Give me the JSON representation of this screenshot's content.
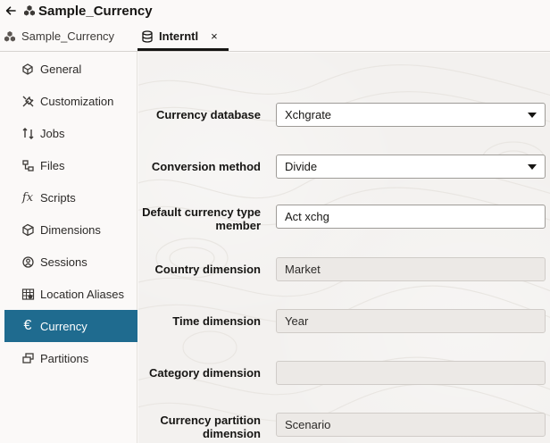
{
  "header": {
    "title": "Sample_Currency",
    "back_icon": "arrow-left-icon",
    "title_icon": "cube-cluster-icon"
  },
  "tabs": [
    {
      "label": "Sample_Currency",
      "icon": "cube-cluster-icon",
      "active": false
    },
    {
      "label": "Interntl",
      "icon": "database-icon",
      "active": true,
      "close": "×"
    }
  ],
  "sidebar": {
    "items": [
      {
        "label": "General",
        "icon": "cube-edit-icon",
        "active": false
      },
      {
        "label": "Customization",
        "icon": "tools-icon",
        "active": false
      },
      {
        "label": "Jobs",
        "icon": "jobs-icon",
        "active": false
      },
      {
        "label": "Files",
        "icon": "files-icon",
        "active": false
      },
      {
        "label": "Scripts",
        "icon": "fx-icon",
        "active": false
      },
      {
        "label": "Dimensions",
        "icon": "cube-dimensions-icon",
        "active": false
      },
      {
        "label": "Sessions",
        "icon": "sessions-icon",
        "active": false
      },
      {
        "label": "Location Aliases",
        "icon": "grid-link-icon",
        "active": false
      },
      {
        "label": "Currency",
        "icon": "euro-icon",
        "active": true
      },
      {
        "label": "Partitions",
        "icon": "partitions-icon",
        "active": false
      }
    ]
  },
  "form": {
    "fields": [
      {
        "label": "Currency database",
        "value": "Xchgrate",
        "type": "select"
      },
      {
        "label": "Conversion method",
        "value": "Divide",
        "type": "select"
      },
      {
        "label": "Default currency type member",
        "value": "Act xchg",
        "type": "input"
      },
      {
        "label": "Country dimension",
        "value": "Market",
        "type": "readonly"
      },
      {
        "label": "Time dimension",
        "value": "Year",
        "type": "readonly"
      },
      {
        "label": "Category dimension",
        "value": "",
        "type": "readonly"
      },
      {
        "label": "Currency partition dimension",
        "value": "Scenario",
        "type": "readonly"
      }
    ]
  },
  "colors": {
    "accent": "#1f6b8f",
    "background": "#fbf9f8",
    "main_background": "#f3f1ef"
  }
}
